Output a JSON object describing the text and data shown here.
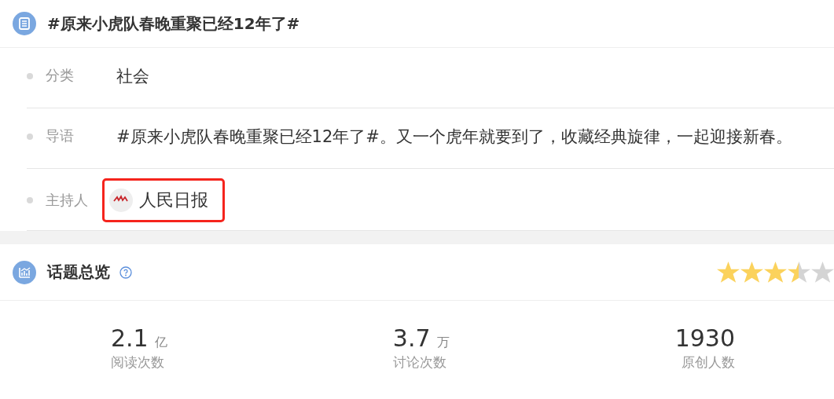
{
  "topic": {
    "title": "#原来小虎队春晚重聚已经12年了#"
  },
  "details": [
    {
      "kind": "text",
      "label": "分类",
      "value": "社会"
    },
    {
      "kind": "text",
      "label": "导语",
      "value": "#原来小虎队春晚重聚已经12年了#。又一个虎年就要到了，收藏经典旋律，一起迎接新春。"
    },
    {
      "kind": "host",
      "label": "主持人",
      "value": "人民日报",
      "highlighted": true
    }
  ],
  "overview": {
    "title": "话题总览",
    "stars": 3.5,
    "stats": [
      {
        "number": "2.1",
        "unit": "亿",
        "label": "阅读次数"
      },
      {
        "number": "3.7",
        "unit": "万",
        "label": "讨论次数"
      },
      {
        "number": "1930",
        "label": "原创人数"
      }
    ]
  }
}
